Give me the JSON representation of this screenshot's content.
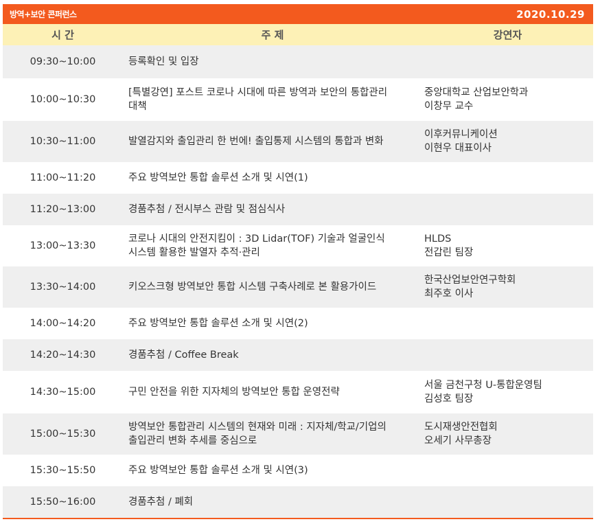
{
  "banner": {
    "title": "방역+보안 콘퍼런스",
    "date": "2020.10.29"
  },
  "header": {
    "time": "시 간",
    "topic": "주 제",
    "speaker": "강연자"
  },
  "rows": [
    {
      "time": "09:30~10:00",
      "topic": [
        "등록확인 및 입장"
      ],
      "speaker": []
    },
    {
      "time": "10:00~10:30",
      "topic": [
        "[특별강연] 포스트 코로나 시대에 따른 방역과 보안의 통합관리",
        "대책"
      ],
      "speaker": [
        "중앙대학교 산업보안학과",
        "이창무 교수"
      ]
    },
    {
      "time": "10:30~11:00",
      "topic": [
        "발열감지와 출입관리 한 번에! 출입통제 시스템의 통합과 변화"
      ],
      "speaker": [
        "이후커뮤니케이션",
        "이현우 대표이사"
      ]
    },
    {
      "time": "11:00~11:20",
      "topic": [
        "주요 방역보안 통합 솔루션 소개 및 시연(1)"
      ],
      "speaker": []
    },
    {
      "time": "11:20~13:00",
      "topic": [
        "경품추첨 / 전시부스 관람 및 점심식사"
      ],
      "speaker": []
    },
    {
      "time": "13:00~13:30",
      "topic": [
        "코로나 시대의 안전지킴이 : 3D Lidar(TOF) 기술과 얼굴인식",
        "시스템 활용한 발열자 추적·관리"
      ],
      "speaker": [
        "HLDS",
        "전갑린 팀장"
      ]
    },
    {
      "time": "13:30~14:00",
      "topic": [
        "키오스크형 방역보안 통합 시스템 구축사례로 본 활용가이드"
      ],
      "speaker": [
        "한국산업보안연구학회",
        "최주호 이사"
      ]
    },
    {
      "time": "14:00~14:20",
      "topic": [
        "주요 방역보안 통합 솔루션 소개 및 시연(2)"
      ],
      "speaker": []
    },
    {
      "time": "14:20~14:30",
      "topic": [
        "경품추첨 / Coffee Break"
      ],
      "speaker": []
    },
    {
      "time": "14:30~15:00",
      "topic": [
        "구민 안전을 위한 지자체의 방역보안 통합 운영전략"
      ],
      "speaker": [
        "서울 금천구청 U-통합운영팀",
        "김성호 팀장"
      ]
    },
    {
      "time": "15:00~15:30",
      "topic": [
        "방역보안 통합관리 시스템의 현재와 미래 : 지자체/학교/기업의",
        "출입관리 변화 추세를 중심으로"
      ],
      "speaker": [
        "도시재생안전협회",
        "오세기 사무총장"
      ]
    },
    {
      "time": "15:30~15:50",
      "topic": [
        "주요 방역보안 통합 솔루션 소개 및 시연(3)"
      ],
      "speaker": []
    },
    {
      "time": "15:50~16:00",
      "topic": [
        "경품추첨 / 폐회"
      ],
      "speaker": []
    }
  ]
}
